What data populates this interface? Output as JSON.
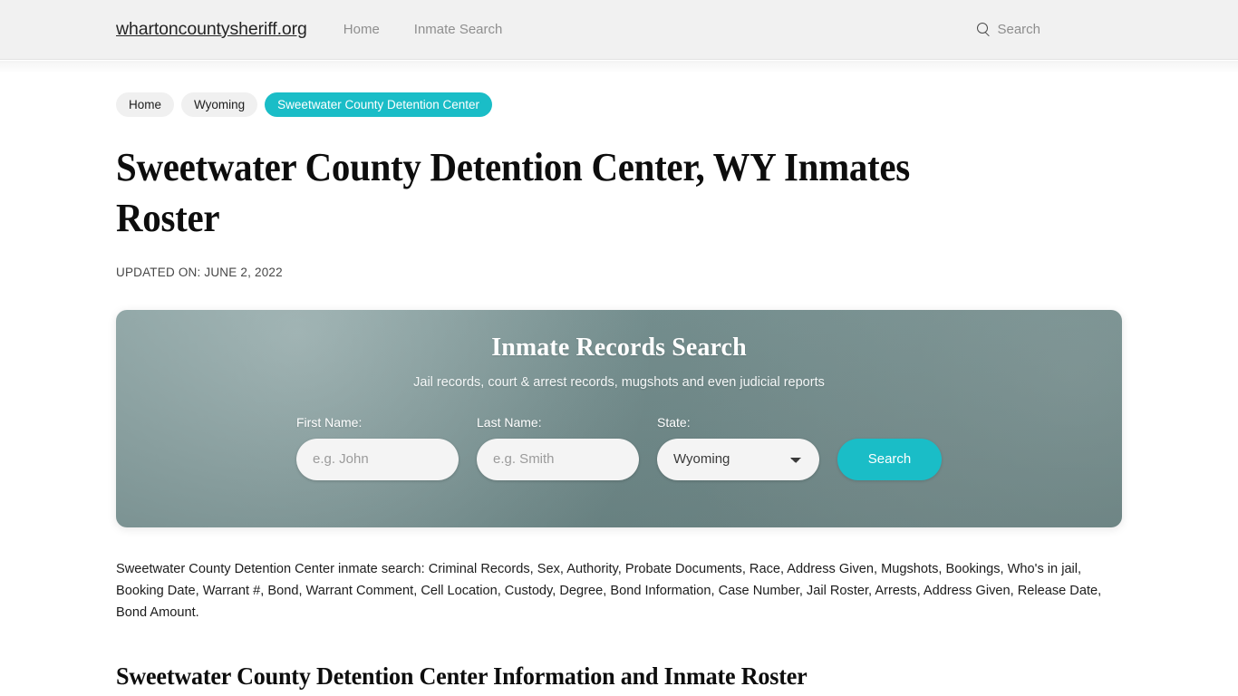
{
  "header": {
    "brand": "whartoncountysheriff.org",
    "nav": [
      {
        "label": "Home"
      },
      {
        "label": "Inmate Search"
      }
    ],
    "search": {
      "icon": "search-icon",
      "label": "Search"
    }
  },
  "breadcrumb": {
    "items": [
      {
        "label": "Home",
        "current": false
      },
      {
        "label": "Wyoming",
        "current": false
      },
      {
        "label": "Sweetwater County Detention Center",
        "current": true
      }
    ]
  },
  "article": {
    "title": "Sweetwater County Detention Center, WY Inmates Roster",
    "updated_on": "UPDATED ON: JUNE 2, 2022",
    "intro_paragraph": "Sweetwater County Detention Center inmate search: Criminal Records, Sex, Authority, Probate Documents, Race, Address Given, Mugshots, Bookings, Who's in jail, Booking Date, Warrant #, Bond, Warrant Comment, Cell Location, Custody, Degree, Bond Information, Case Number, Jail Roster, Arrests, Address Given, Release Date, Bond Amount.",
    "section_heading": "Sweetwater County Detention Center Information and Inmate Roster"
  },
  "search_card": {
    "title": "Inmate Records Search",
    "subtitle": "Jail records, court & arrest records, mugshots and even judicial reports",
    "fields": {
      "first_name": {
        "label": "First Name:",
        "placeholder": "e.g. John",
        "value": ""
      },
      "last_name": {
        "label": "Last Name:",
        "placeholder": "e.g. Smith",
        "value": ""
      },
      "state": {
        "label": "State:",
        "selected": "Wyoming",
        "options": [
          "Wyoming"
        ]
      }
    },
    "submit_label": "Search"
  },
  "colors": {
    "accent_teal": "#1abdc7",
    "header_background": "#f1f1f1",
    "card_background": "#6e8a8a",
    "page_background": "#ffffff",
    "nav_link": "#8f8f8f"
  }
}
